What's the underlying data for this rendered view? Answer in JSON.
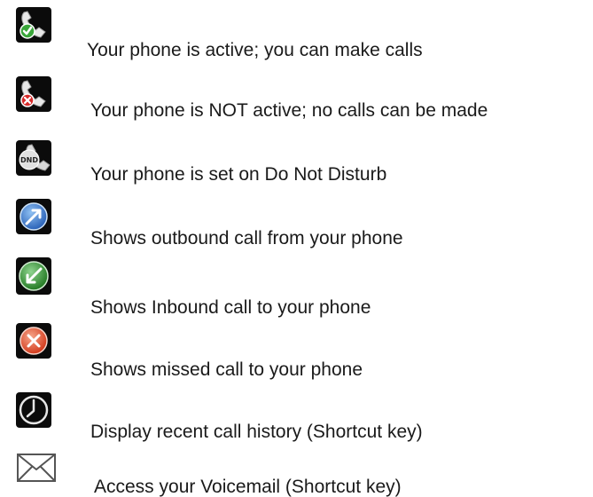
{
  "legend": {
    "items": [
      {
        "icon": "phone-active-icon",
        "label": "Your phone is active; you can make calls"
      },
      {
        "icon": "phone-inactive-icon",
        "label": "Your phone is NOT active; no calls can be made"
      },
      {
        "icon": "dnd-icon",
        "label": "Your phone is set on Do Not Disturb"
      },
      {
        "icon": "outbound-call-icon",
        "label": "Shows outbound call from your phone"
      },
      {
        "icon": "inbound-call-icon",
        "label": "Shows Inbound call to your phone"
      },
      {
        "icon": "missed-call-icon",
        "label": "Shows missed call to your phone"
      },
      {
        "icon": "clock-icon",
        "label": "Display recent call history (Shortcut key)"
      },
      {
        "icon": "envelope-icon",
        "label": "Access your Voicemail (Shortcut key)"
      }
    ],
    "dnd_text": "DND",
    "colors": {
      "tile": "#0b0b0b",
      "active": "#3aa63a",
      "inactive": "#d62b2b",
      "outbound": "#3f7fd0",
      "inbound": "#3c9a3c",
      "missed": "#e04a2a"
    }
  }
}
